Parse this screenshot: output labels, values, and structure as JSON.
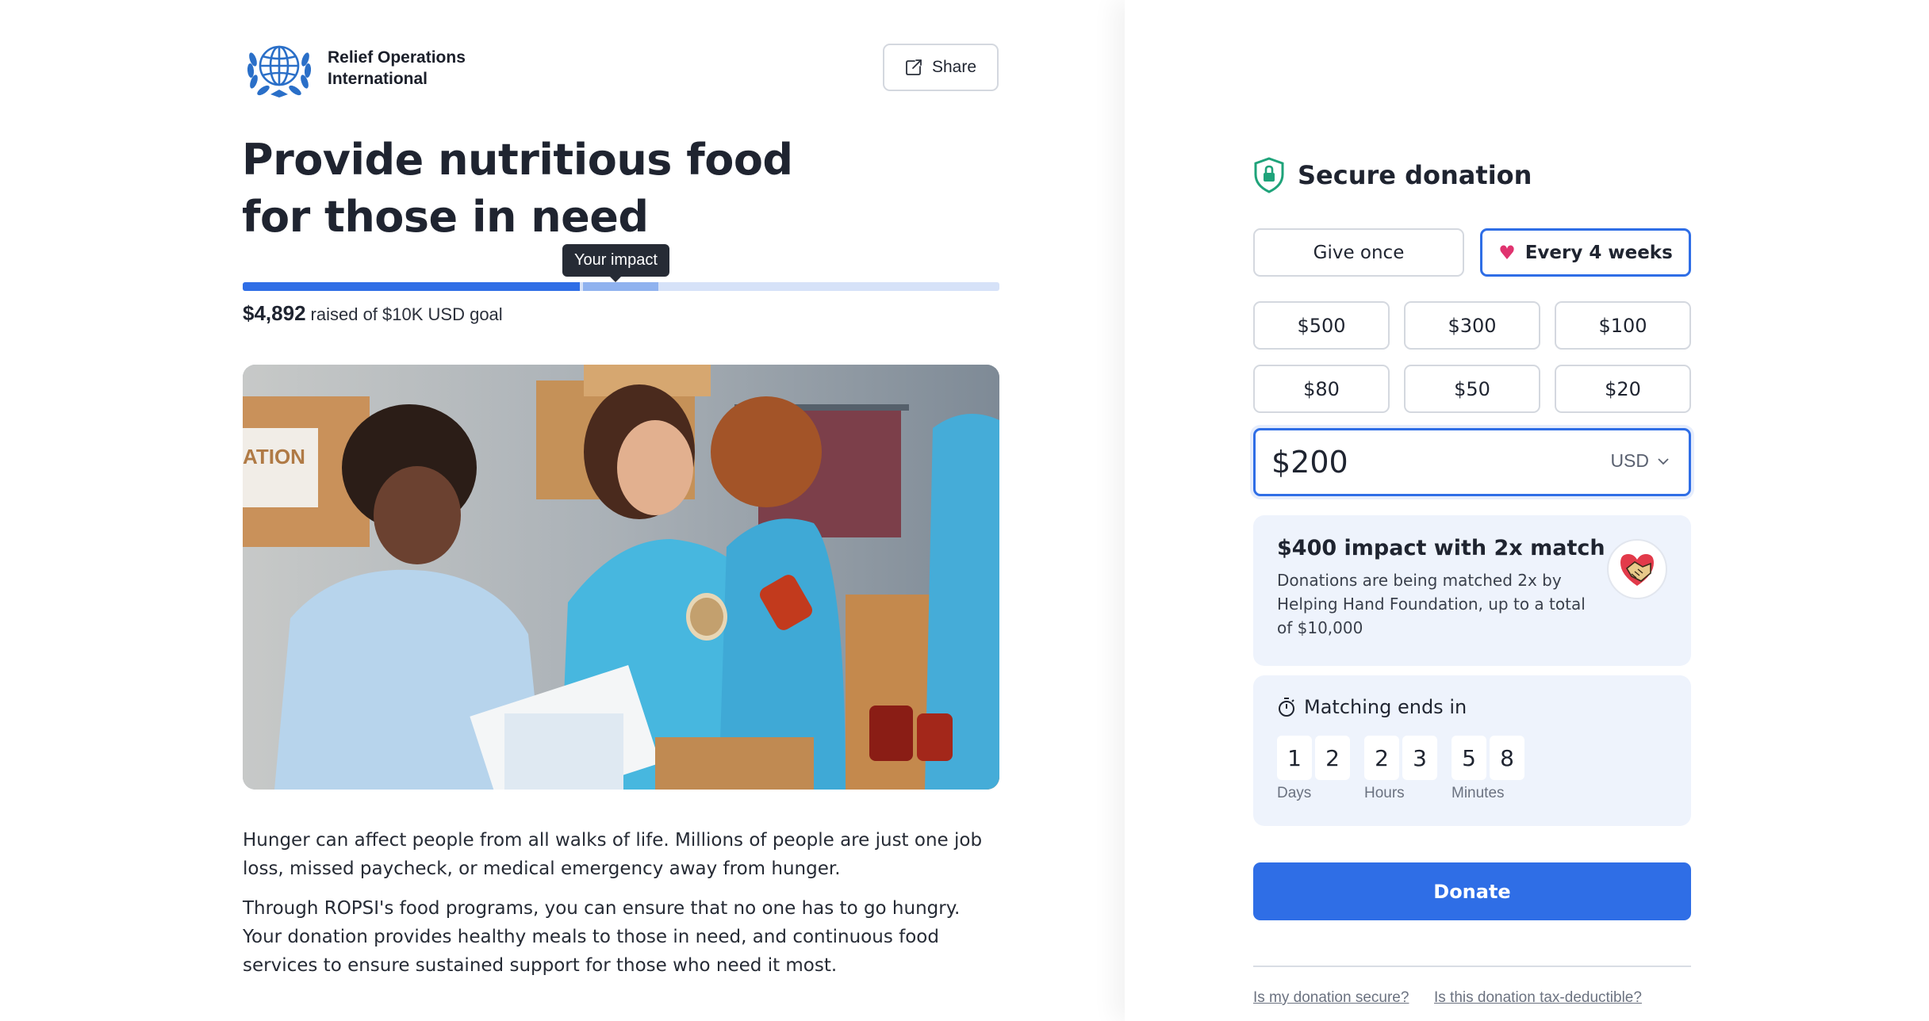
{
  "org": {
    "name_line1": "Relief Operations",
    "name_line2": "International"
  },
  "share": {
    "label": "Share"
  },
  "campaign": {
    "title": "Provide nutritious food for those in need",
    "tooltip": "Your impact",
    "raised_amount": "$4,892",
    "raised_suffix": "raised of $10K USD goal",
    "progress_raised_fraction": 0.4457,
    "progress_impact_fraction": 0.1037,
    "description": [
      "Hunger can affect people from all walks of life. Millions of people are just one job loss, missed paycheck, or medical emergency away from hunger.",
      "Through ROPSI's food programs, you can ensure that no one has to go hungry. Your donation provides healthy meals to those in need, and continuous food services to ensure sustained support for those who need it most."
    ],
    "image_text": "ATION"
  },
  "donation": {
    "title": "Secure donation",
    "frequency": {
      "options": [
        "Give once",
        "Every 4 weeks"
      ],
      "selected": "Every 4 weeks"
    },
    "amounts": [
      "$500",
      "$300",
      "$100",
      "$80",
      "$50",
      "$20"
    ],
    "amount_value": "$200",
    "currency": "USD",
    "match": {
      "title": "$400 impact with 2x match",
      "text": "Donations are being matched 2x by Helping Hand Foundation, up to a total of $10,000"
    },
    "timer": {
      "title": "Matching ends in",
      "days": [
        "1",
        "2"
      ],
      "hours": [
        "2",
        "3"
      ],
      "minutes": [
        "5",
        "8"
      ],
      "labels": {
        "days": "Days",
        "hours": "Hours",
        "minutes": "Minutes"
      }
    },
    "donate_label": "Donate",
    "links": [
      "Is my donation secure?",
      "Is this donation tax-deductible?"
    ]
  },
  "colors": {
    "accent": "#2f6ee6",
    "progress_track": "#d6e2f8",
    "card_bg": "#eef3fc",
    "heart": "#e0336f",
    "shield": "#1fa37a",
    "logo": "#2a6fc8"
  }
}
